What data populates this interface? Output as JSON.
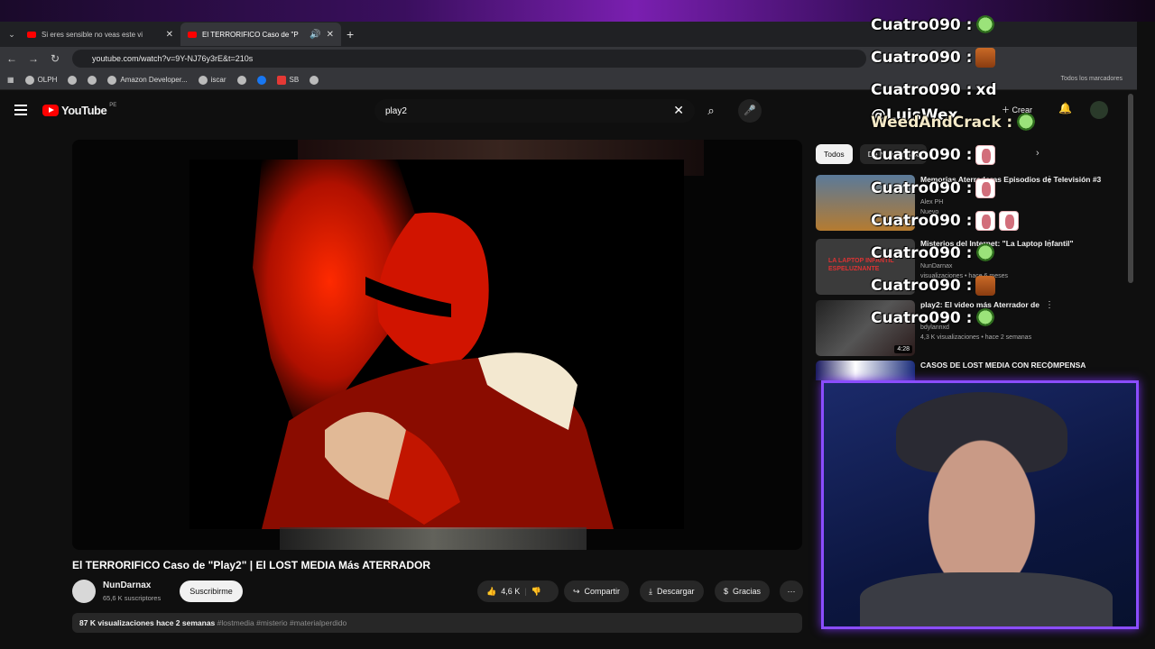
{
  "browser": {
    "tabs": [
      {
        "label": "Si eres sensible no veas este vi",
        "active": false
      },
      {
        "label": "El TERRORIFICO Caso de \"P",
        "active": true
      }
    ],
    "url": "youtube.com/watch?v=9Y-NJ76y3rE&t=210s",
    "bookmarks": [
      "OLPH",
      "Amazon Developer...",
      "iscar",
      "SB"
    ],
    "bookmarks_right": "Todos los marcadores"
  },
  "youtube": {
    "logo": "YouTube",
    "country": "PE",
    "search_value": "play2",
    "create_label": "Crear"
  },
  "video": {
    "title": "El TERRORIFICO Caso de \"Play2\" | El LOST MEDIA Más ATERRADOR",
    "channel": "NunDarnax",
    "subscribers": "65,6 K suscriptores",
    "subscribe_label": "Suscribirme",
    "likes": "4,6 K",
    "share_label": "Compartir",
    "download_label": "Descargar",
    "thanks_label": "Gracias",
    "views": "87 K visualizaciones",
    "age": "hace 2 semanas",
    "tags": "#lostmedia #misterio #materialperdido"
  },
  "sidebar": {
    "chips": [
      "Todos",
      "De NunDarnax"
    ],
    "recs": [
      {
        "title": "Memorias Aterradoras Episodios de Televisión #3",
        "channel": "Alex PH",
        "meta": "Nuevo",
        "duration": ""
      },
      {
        "title": "Misterios del Internet: \"La Laptop Infantil\"",
        "channel": "NunDarnax",
        "meta": "visualizaciones • hace 6 meses",
        "duration": "",
        "thumb_text": "LA LAPTOP INFANTIL ESPELUZNANTE"
      },
      {
        "title": "play2: El video más Aterrador de",
        "channel": "bdylannxd",
        "meta": "4,3 K visualizaciones • hace 2 semanas",
        "duration": "4:28"
      },
      {
        "title": "CASOS DE LOST MEDIA CON RECOMPENSA",
        "channel": "",
        "meta": "",
        "duration": ""
      }
    ]
  },
  "chat": [
    {
      "user": "Cuatro090",
      "msg": "",
      "emotes": [
        "green"
      ]
    },
    {
      "user": "Cuatro090",
      "msg": "",
      "emotes": [
        "orange"
      ]
    },
    {
      "user": "Cuatro090",
      "msg": "xd",
      "emotes": []
    },
    {
      "user": "@LuisWex",
      "msg": "",
      "emotes": []
    },
    {
      "user": "WeedAndCrack",
      "msg": "",
      "emotes": [
        "green"
      ]
    },
    {
      "user": "Cuatro090",
      "msg": "",
      "emotes": [
        "pink"
      ]
    },
    {
      "user": "Cuatro090",
      "msg": "",
      "emotes": [
        "pink"
      ]
    },
    {
      "user": "Cuatro090",
      "msg": "",
      "emotes": [
        "pink",
        "pink"
      ]
    },
    {
      "user": "Cuatro090",
      "msg": "",
      "emotes": [
        "green"
      ]
    },
    {
      "user": "Cuatro090",
      "msg": "",
      "emotes": [
        "orange"
      ]
    },
    {
      "user": "Cuatro090",
      "msg": "",
      "emotes": [
        "green"
      ]
    }
  ],
  "colors": {
    "accent": "#ff0000",
    "cam_border": "#8b4dff"
  }
}
